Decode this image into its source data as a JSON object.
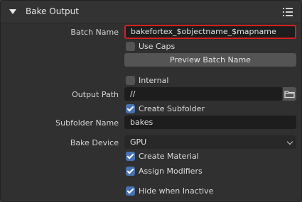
{
  "panel": {
    "title": "Bake Output",
    "batch_name_label": "Batch Name",
    "batch_name_value": "bakefortex_$objectname_$mapname",
    "use_caps_label": "Use Caps",
    "use_caps_checked": false,
    "preview_button": "Preview Batch Name",
    "internal_label": "Internal",
    "internal_checked": false,
    "output_path_label": "Output Path",
    "output_path_value": "//",
    "create_subfolder_label": "Create Subfolder",
    "create_subfolder_checked": true,
    "subfolder_name_label": "Subfolder Name",
    "subfolder_name_value": "bakes",
    "bake_device_label": "Bake Device",
    "bake_device_value": "GPU",
    "create_material_label": "Create Material",
    "create_material_checked": true,
    "assign_modifiers_label": "Assign Modifiers",
    "assign_modifiers_checked": true,
    "hide_inactive_label": "Hide when Inactive",
    "hide_inactive_checked": true
  },
  "colors": {
    "highlight_border": "#d81e1e",
    "checkbox_on": "#4772b3"
  }
}
